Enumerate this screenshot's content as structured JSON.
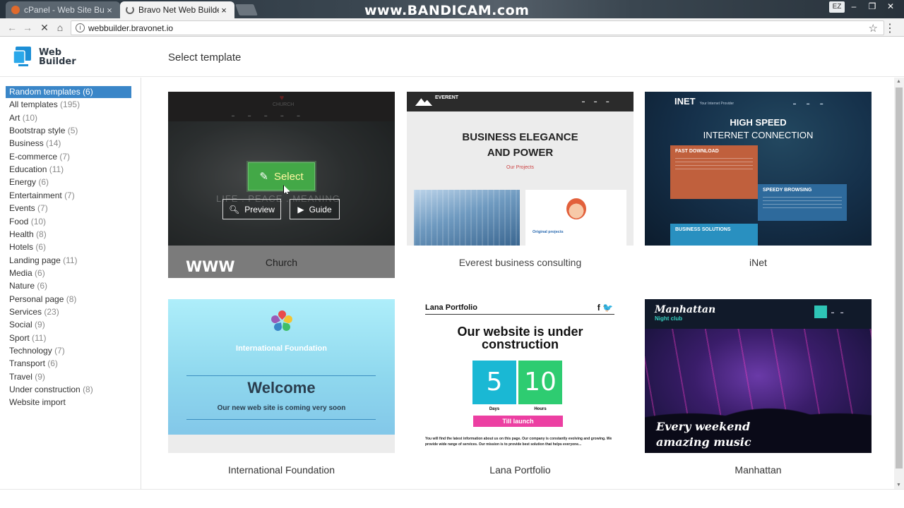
{
  "browser": {
    "tabs": [
      {
        "title": "cPanel - Web Site Builder",
        "close": "×"
      },
      {
        "title": "Bravo Net Web Builder",
        "close": "×"
      }
    ],
    "watermark": "www.BANDICAM.com",
    "profile": "EZ",
    "window_controls": {
      "minimize": "–",
      "maximize": "❐",
      "close": "✕"
    },
    "nav": {
      "back": "←",
      "forward": "→",
      "stop": "✕",
      "home": "⌂"
    },
    "url": "webbuilder.bravonet.io",
    "star": "☆",
    "menu": "⋮"
  },
  "header": {
    "logo_line1": "Web",
    "logo_line2": "Builder",
    "title": "Select template"
  },
  "categories": [
    {
      "name": "Random templates",
      "count": "(6)"
    },
    {
      "name": "All templates",
      "count": "(195)"
    },
    {
      "name": "Art",
      "count": "(10)"
    },
    {
      "name": "Bootstrap style",
      "count": "(5)"
    },
    {
      "name": "Business",
      "count": "(14)"
    },
    {
      "name": "E-commerce",
      "count": "(7)"
    },
    {
      "name": "Education",
      "count": "(11)"
    },
    {
      "name": "Energy",
      "count": "(6)"
    },
    {
      "name": "Entertainment",
      "count": "(7)"
    },
    {
      "name": "Events",
      "count": "(7)"
    },
    {
      "name": "Food",
      "count": "(10)"
    },
    {
      "name": "Health",
      "count": "(8)"
    },
    {
      "name": "Hotels",
      "count": "(6)"
    },
    {
      "name": "Landing page",
      "count": "(11)"
    },
    {
      "name": "Media",
      "count": "(6)"
    },
    {
      "name": "Nature",
      "count": "(6)"
    },
    {
      "name": "Personal page",
      "count": "(8)"
    },
    {
      "name": "Services",
      "count": "(23)"
    },
    {
      "name": "Social",
      "count": "(9)"
    },
    {
      "name": "Sport",
      "count": "(11)"
    },
    {
      "name": "Technology",
      "count": "(7)"
    },
    {
      "name": "Transport",
      "count": "(6)"
    },
    {
      "name": "Travel",
      "count": "(9)"
    },
    {
      "name": "Under construction",
      "count": "(8)"
    },
    {
      "name": "Website import",
      "count": ""
    }
  ],
  "selected_category": "Random templates",
  "templates": [
    {
      "name": "Church",
      "thumb": {
        "logo": "CHURCH",
        "ghost_text": "LIFE . PEACE . MEANING"
      },
      "actions": {
        "select": "Select",
        "preview": "Preview",
        "guide": "Guide"
      }
    },
    {
      "name": "Everest business consulting",
      "thumb": {
        "brand": "EVERENT",
        "headline_1": "BUSINESS ELEGANCE",
        "headline_2": "AND POWER",
        "link": "Our Projects",
        "card_title": "Original projects"
      }
    },
    {
      "name": "iNet",
      "thumb": {
        "brand": "INET",
        "tagline": "Your Internet Provider",
        "headline_1": "HIGH SPEED",
        "headline_2": "INTERNET CONNECTION",
        "box1": "FAST DOWNLOAD",
        "box2": "SPEEDY BROWSING",
        "box3": "BUSINESS SOLUTIONS"
      }
    },
    {
      "name": "International Foundation",
      "thumb": {
        "org": "International Foundation",
        "headline": "Welcome",
        "subline": "Our new web site is coming very soon"
      }
    },
    {
      "name": "Lana Portfolio",
      "thumb": {
        "header": "Lana Portfolio",
        "social": "f 🐦",
        "headline_1": "Our website is under",
        "headline_2": "construction",
        "days_value": "5",
        "days_label": "Days",
        "hours_value": "10",
        "hours_label": "Hours",
        "button": "Till launch",
        "paragraph": "You will find the latest information about us on this page. Our company is constantly evolving and growing. We provide wide range of services. Our mission is to provide best solution that helps everyone..."
      }
    },
    {
      "name": "Manhattan",
      "thumb": {
        "brand": "Manhattan",
        "tagline": "Night club",
        "slogan_1": "Every weekend",
        "slogan_2": "amazing music"
      }
    }
  ],
  "overlay_watermark": "WWW",
  "colors": {
    "selected_bg": "#3a86c8",
    "select_button": "#43a847",
    "lana_cyan": "#1ab8d4",
    "lana_green": "#2ecc71",
    "lana_pink": "#ec3fa2"
  }
}
